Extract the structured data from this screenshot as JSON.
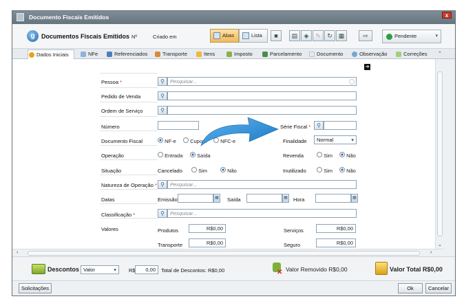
{
  "window": {
    "title": "Documento Fiscais Emitidos",
    "close": "x"
  },
  "toolbar": {
    "app_title": "Documentos Fiscais Emitidos",
    "numero_label": "Nº",
    "criado_label": "Criado em",
    "view_abas": "Abas",
    "view_lista": "Lista",
    "status": "Pendente"
  },
  "tabs": [
    {
      "label": "Dados Iniciais",
      "color": "#e8a31a"
    },
    {
      "label": "NFe",
      "color": "#8fb3d6"
    },
    {
      "label": "Referenciados",
      "color": "#4d7fb5"
    },
    {
      "label": "Transporte",
      "color": "#d88a3a"
    },
    {
      "label": "Itens",
      "color": "#f0b83a"
    },
    {
      "label": "Imposto",
      "color": "#8ab04a"
    },
    {
      "label": "Parcelamento",
      "color": "#4a8c4a"
    },
    {
      "label": "Documento",
      "color": "#b8c4cc"
    },
    {
      "label": "Observação",
      "color": "#7aa6d0"
    },
    {
      "label": "Correções",
      "color": "#9fd07a"
    }
  ],
  "form": {
    "pessoa": {
      "label": "Pessoa",
      "placeholder": "Pesquisar..."
    },
    "pedido": {
      "label": "Pedido de Venda"
    },
    "ordem": {
      "label": "Ordem de Serviço"
    },
    "numero": {
      "label": "Número"
    },
    "serie": {
      "label": "Série Fiscal"
    },
    "documento_fiscal": {
      "label": "Documento Fiscal",
      "options": [
        "NF-e",
        "Cupom",
        "NFC-e"
      ],
      "selected": "NF-e"
    },
    "finalidade": {
      "label": "Finalidade",
      "value": "Normal"
    },
    "operacao": {
      "label": "Operação",
      "options": [
        "Entrada",
        "Saída"
      ],
      "selected": "Saída"
    },
    "revenda": {
      "label": "Revenda",
      "options": [
        "Sim",
        "Não"
      ],
      "selected": "Não"
    },
    "situacao": {
      "label": "Situação",
      "value": "Cancelado",
      "options": [
        "Sim",
        "Não"
      ],
      "selected": "Não"
    },
    "inutilizado": {
      "label": "Inutilizado",
      "options": [
        "Sim",
        "Não"
      ],
      "selected": "Não"
    },
    "natureza": {
      "label": "Natureza de Operação",
      "placeholder": "Pesquisar..."
    },
    "datas": {
      "label": "Datas",
      "emissao": "Emissão",
      "saida": "Saída",
      "hora": "Hora"
    },
    "classificacao": {
      "label": "Classificação",
      "placeholder": "Pesquisar..."
    },
    "valores": {
      "label": "Valores",
      "produtos": {
        "label": "Produtos",
        "value": "R$0,00"
      },
      "servicos": {
        "label": "Serviços",
        "value": "R$0,00"
      },
      "transporte": {
        "label": "Transporte",
        "value": "R$0,00"
      },
      "seguro": {
        "label": "Seguro",
        "value": "R$0,00"
      }
    }
  },
  "footer": {
    "descontos_label": "Descontos",
    "desconto_tipo": "Valor",
    "currency": "R$",
    "desconto_valor": "0,00",
    "total_descontos": "Total de Descontos: R$0,00",
    "valor_removido": "Valor Removido R$0,00",
    "valor_total": "Valor Total R$0,00"
  },
  "buttons": {
    "solicitacoes": "Solicitações",
    "ok": "Ok",
    "cancelar": "Cancelar"
  }
}
